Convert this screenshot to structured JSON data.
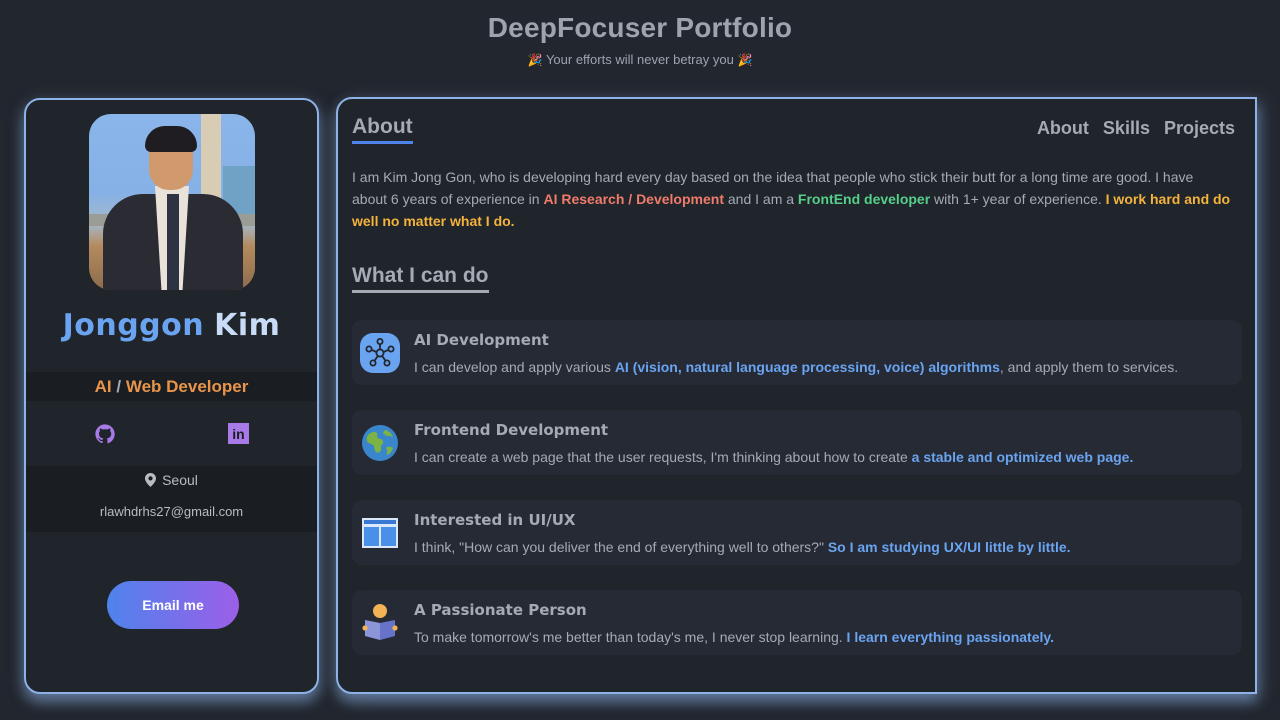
{
  "header": {
    "title": "DeepFocuser Portfolio",
    "subtitle": "Your efforts will never betray you",
    "subtitle_icon": "🎉"
  },
  "profile": {
    "photo_alt": "Profile photo of Jonggon Kim in a suit",
    "first_name": "Jonggon",
    "last_name": "Kim",
    "role_ai": "AI",
    "role_slash": "/",
    "role_web": "Web Developer",
    "socials": [
      {
        "name": "github",
        "icon": "github-icon"
      },
      {
        "name": "linkedin",
        "icon": "linkedin-icon",
        "glyph": "in"
      }
    ],
    "location": "Seoul",
    "email": "rlawhdrhs27@gmail.com",
    "email_button": "Email me"
  },
  "main": {
    "about_title": "About",
    "nav": [
      "About",
      "Skills",
      "Projects"
    ],
    "about": {
      "p1": "I am Kim Jong Gon, who is developing hard every day based on the idea that people who stick their butt for a long time are good. I have about 6 years of experience in ",
      "hl1": "AI Research / Development",
      "p2": " and I am a ",
      "hl2": "FrontEnd developer",
      "p3": " with 1+ year of experience. ",
      "hl3": "I work hard and do well no matter what I do."
    },
    "skills_title": "What I can do",
    "skills": [
      {
        "icon": "network-nodes-icon",
        "title": "AI Development",
        "text": "I can develop and apply various ",
        "highlight": "AI (vision, natural language processing, voice) algorithms",
        "suffix": ", and apply them to services."
      },
      {
        "icon": "globe-icon",
        "title": "Frontend Development",
        "text": "I can create a web page that the user requests, I'm thinking about how to create ",
        "highlight": "a stable and optimized web page.",
        "suffix": ""
      },
      {
        "icon": "layout-icon",
        "title": "Interested in UI/UX",
        "text": "I think, \"How can you deliver the end of everything well to others?\" ",
        "highlight": "So I am studying UX/UI little by little.",
        "suffix": ""
      },
      {
        "icon": "reading-person-icon",
        "title": "A Passionate Person",
        "text": "To make tomorrow's me better than today's me, I never stop learning. ",
        "highlight": "I learn everything passionately.",
        "suffix": ""
      }
    ]
  },
  "colors": {
    "background": "#22262e",
    "panel": "#20242b",
    "border_glow": "#8db2e8",
    "accent_blue": "#6aa4f0",
    "accent_orange": "#e8954a",
    "accent_red": "#ef7b6b",
    "accent_green": "#55cf8a",
    "accent_yellow": "#f4b33c",
    "accent_purple": "#a77ae8"
  }
}
